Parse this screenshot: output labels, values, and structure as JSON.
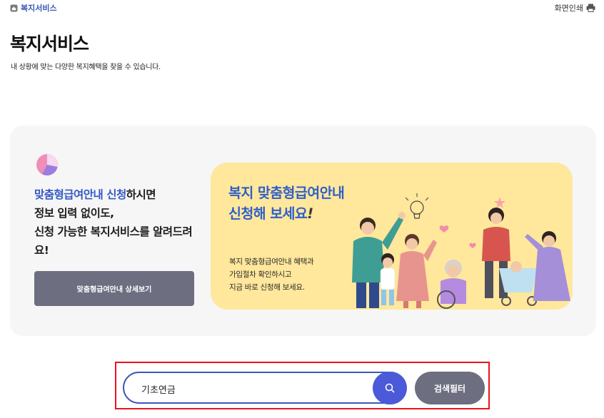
{
  "breadcrumb": {
    "icon": "home-icon",
    "label": "복지서비스"
  },
  "toolbar": {
    "print_label": "화면인쇄",
    "print_icon": "print-icon"
  },
  "page": {
    "title": "복지서비스",
    "description": "내 상황에 맞는 다양한 복지혜택을 찾을 수 있습니다."
  },
  "promo": {
    "icon": "pie-chart-icon",
    "highlight": "맞춤형급여안내 신청",
    "line1_rest": "하시면",
    "line2": "정보 입력 없이도,",
    "line3": "신청 가능한 복지서비스를 알려드려요!",
    "detail_button": "맞춤형급여안내 상세보기",
    "banner": {
      "title_line1": "복지 맞춤형급여안내",
      "title_line2": "신청해 보세요",
      "title_mark": "!",
      "sub_line1": "복지 맞춤형급여안내 혜택과",
      "sub_line2": "가입절차 확인하시고",
      "sub_line3": "지금 바로 신청해 보세요."
    }
  },
  "search": {
    "value": "기초연금",
    "search_icon": "search-icon",
    "filter_button": "검색필터"
  },
  "colors": {
    "accent": "#3459c4",
    "banner_bg": "#ffe79c",
    "button_gray": "#6d6e80",
    "search_blue": "#4a5ad8",
    "highlight_box": "#e8141c"
  }
}
